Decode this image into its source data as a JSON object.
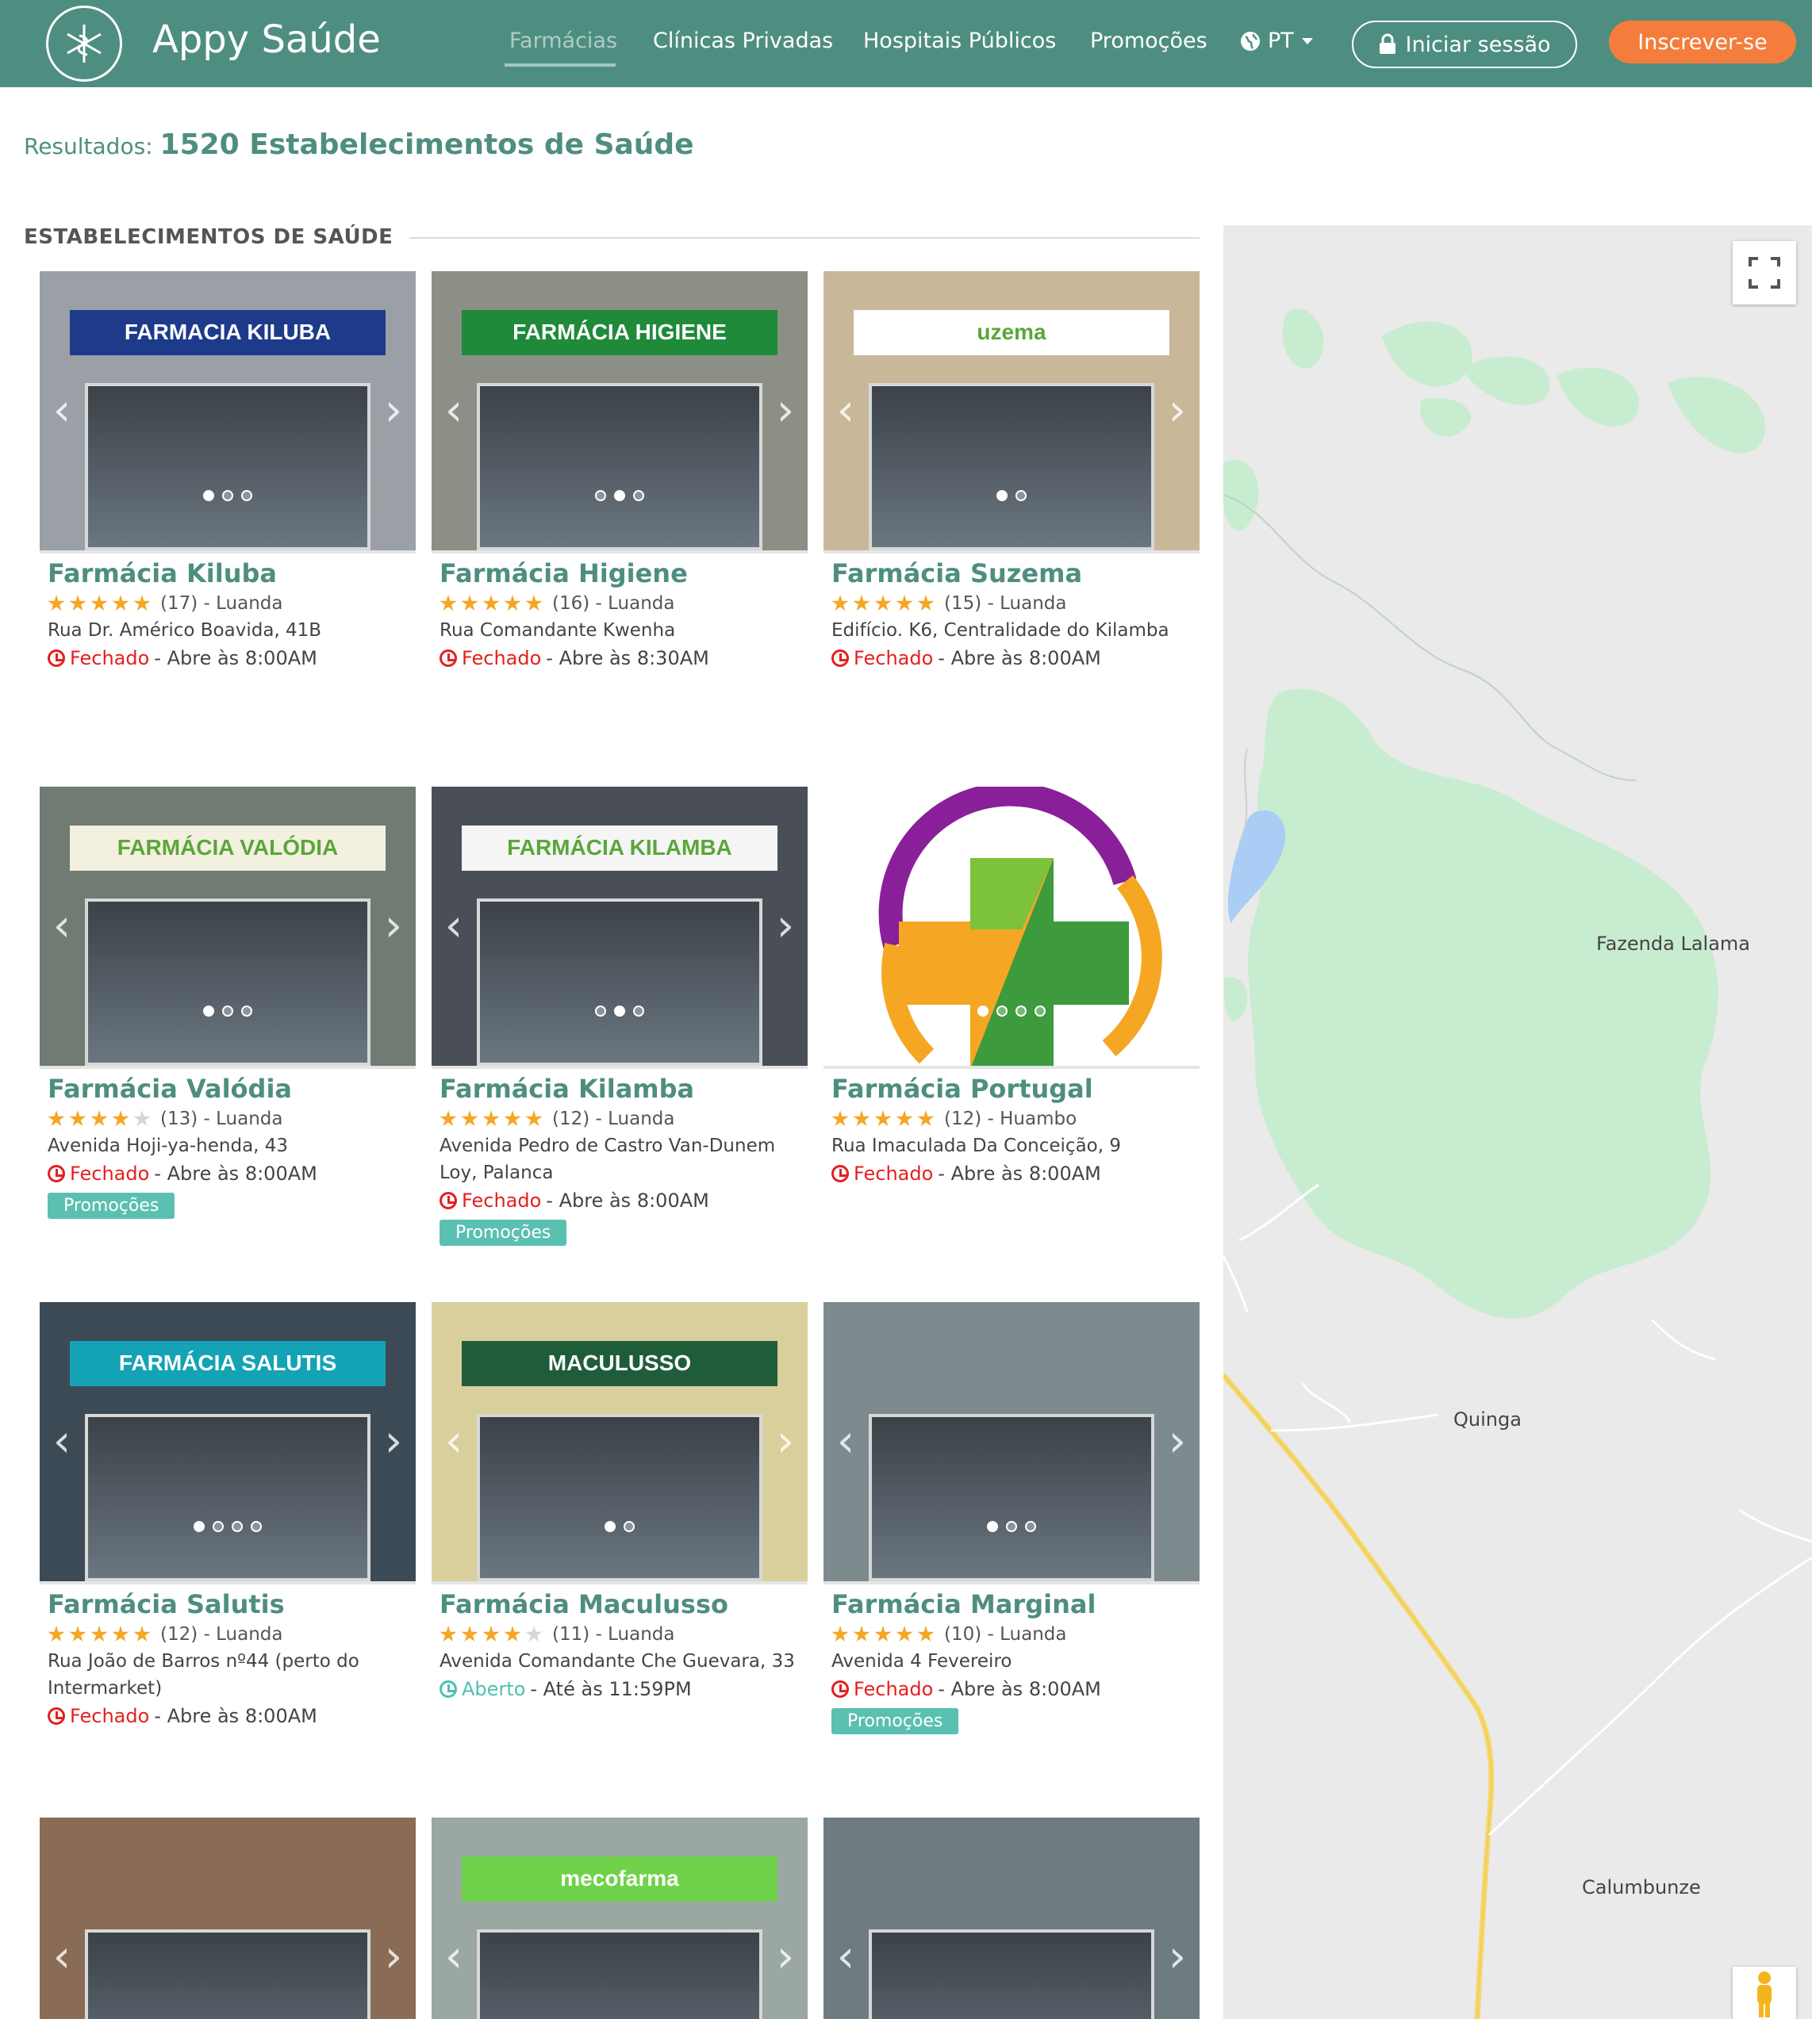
{
  "header": {
    "app_name": "Appy Saúde",
    "nav": [
      "Farmácias",
      "Clínicas Privadas",
      "Hospitais Públicos",
      "Promoções"
    ],
    "lang": "PT",
    "login": "Iniciar sessão",
    "signup": "Inscrever-se",
    "colors": {
      "bar": "#4e8e80",
      "signup": "#f47c3c"
    }
  },
  "results": {
    "label": "Resultados:",
    "value": "1520 Estabelecimentos de Saúde"
  },
  "section_title": "ESTABELECIMENTOS DE SAÚDE",
  "cards": [
    {
      "name": "Farmácia Kiluba",
      "rating": 5,
      "info": "(17) - Luanda",
      "address": "Rua Dr. Américo Boavida, 41B",
      "status": "Fechado",
      "status_type": "closed",
      "hours": "- Abre às 8:00AM",
      "promo": "",
      "dots": 3,
      "active_dot": 0,
      "sign_text": "FARMACIA KILUBA",
      "sign_color": "#1e3a8a",
      "bg": "#9aa0a6"
    },
    {
      "name": "Farmácia Higiene",
      "rating": 5,
      "info": "(16) - Luanda",
      "address": "Rua Comandante Kwenha",
      "status": "Fechado",
      "status_type": "closed",
      "hours": "- Abre às 8:30AM",
      "promo": "",
      "dots": 3,
      "active_dot": 1,
      "sign_text": "FARMÁCIA HIGIENE",
      "sign_color": "#1f8a3a",
      "bg": "#8b8f86"
    },
    {
      "name": "Farmácia Suzema",
      "rating": 5,
      "info": "(15) - Luanda",
      "address": "Edifício. K6, Centralidade do Kilamba",
      "status": "Fechado",
      "status_type": "closed",
      "hours": "- Abre às 8:00AM",
      "promo": "",
      "dots": 2,
      "active_dot": 0,
      "sign_text": "uzema",
      "sign_color": "#ffffff",
      "bg": "#c9b79a"
    },
    {
      "name": "Farmácia Valódia",
      "rating": 4,
      "info": "(13) - Luanda",
      "address": "Avenida Hoji-ya-henda, 43",
      "status": "Fechado",
      "status_type": "closed",
      "hours": "- Abre às 8:00AM",
      "promo": "Promoções",
      "dots": 3,
      "active_dot": 0,
      "sign_text": "FARMÁCIA VALÓDIA",
      "sign_color": "#f3f0e0",
      "bg": "#6f7b73"
    },
    {
      "name": "Farmácia Kilamba",
      "rating": 5,
      "info": "(12) - Luanda",
      "address": "Avenida Pedro de Castro Van-Dunem Loy, Palanca",
      "status": "Fechado",
      "status_type": "closed",
      "hours": "- Abre às 8:00AM",
      "promo": "Promoções",
      "dots": 3,
      "active_dot": 1,
      "sign_text": "FARMÁCIA KILAMBA",
      "sign_color": "#f5f5f5",
      "bg": "#4a4f57"
    },
    {
      "name": "Farmácia Portugal",
      "rating": 5,
      "info": "(12) - Huambo",
      "address": "Rua Imaculada Da Conceição, 9",
      "status": "Fechado",
      "status_type": "closed",
      "hours": "- Abre às 8:00AM",
      "promo": "",
      "dots": 4,
      "active_dot": 0,
      "sign_text": "",
      "sign_color": "#ffffff",
      "bg": "#ffffff"
    },
    {
      "name": "Farmácia Salutis",
      "rating": 5,
      "info": "(12) - Luanda",
      "address": "Rua João de Barros nº44 (perto do Intermarket)",
      "status": "Fechado",
      "status_type": "closed",
      "hours": "- Abre às 8:00AM",
      "promo": "",
      "dots": 4,
      "active_dot": 0,
      "sign_text": "FARMÁCIA SALUTIS",
      "sign_color": "#13a3b5",
      "bg": "#3b4a55"
    },
    {
      "name": "Farmácia Maculusso",
      "rating": 4,
      "info": "(11) - Luanda",
      "address": "Avenida Comandante Che Guevara, 33",
      "status": "Aberto",
      "status_type": "open",
      "hours": "- Até às 11:59PM",
      "promo": "",
      "dots": 2,
      "active_dot": 0,
      "sign_text": "MACULUSSO",
      "sign_color": "#1f5d3a",
      "bg": "#d9cf9c"
    },
    {
      "name": "Farmácia Marginal",
      "rating": 5,
      "info": "(10) - Luanda",
      "address": "Avenida 4 Fevereiro",
      "status": "Fechado",
      "status_type": "closed",
      "hours": "- Abre às 8:00AM",
      "promo": "Promoções",
      "dots": 3,
      "active_dot": 0,
      "sign_text": "",
      "sign_color": "#ffffff",
      "bg": "#7d8a8e"
    },
    {
      "name": "",
      "rating": 0,
      "info": "",
      "address": "",
      "status": "",
      "status_type": "",
      "hours": "",
      "promo": "",
      "dots": 0,
      "active_dot": 0,
      "sign_text": "",
      "sign_color": "#ffffff",
      "bg": "#8a6b55"
    },
    {
      "name": "",
      "rating": 0,
      "info": "",
      "address": "",
      "status": "",
      "status_type": "",
      "hours": "",
      "promo": "",
      "dots": 0,
      "active_dot": 0,
      "sign_text": "mecofarma",
      "sign_color": "#6fd24a",
      "bg": "#9aa7a3"
    },
    {
      "name": "",
      "rating": 0,
      "info": "",
      "address": "",
      "status": "",
      "status_type": "",
      "hours": "",
      "promo": "",
      "dots": 0,
      "active_dot": 0,
      "sign_text": "",
      "sign_color": "#ffffff",
      "bg": "#6e7c82"
    }
  ],
  "map": {
    "labels": [
      "Fazenda Lalama",
      "Quinga",
      "Calumbunze"
    ],
    "colors": {
      "land": "#eaeaea",
      "park": "#c8ecd0",
      "road": "#f6d86b",
      "water": "#a9cdf5"
    }
  }
}
